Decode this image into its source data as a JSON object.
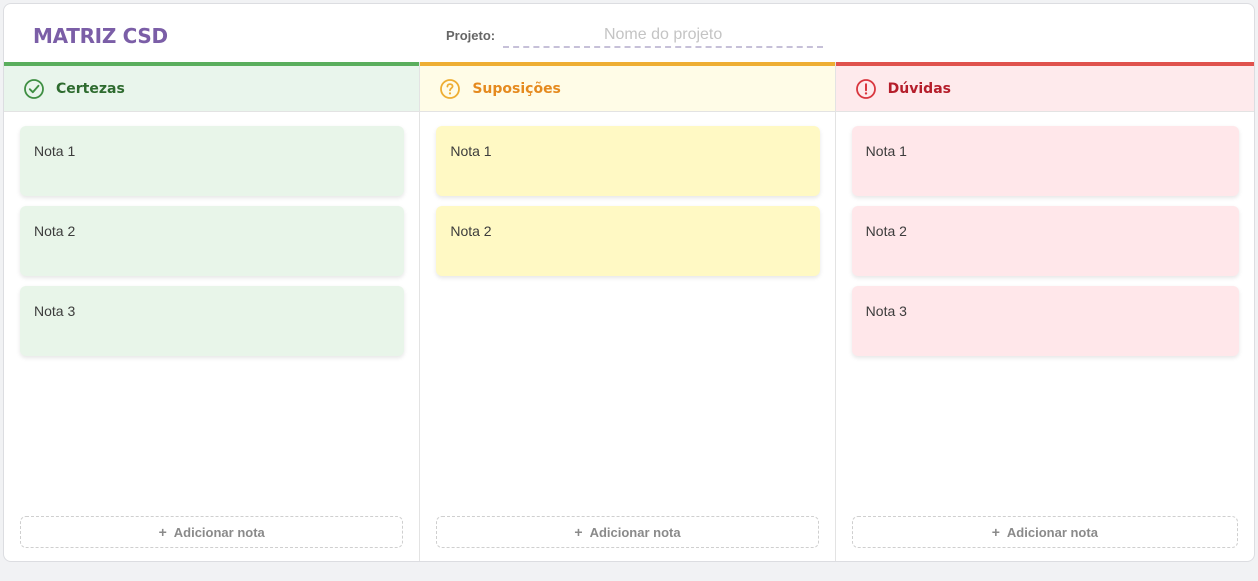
{
  "header": {
    "title": "MATRIZ CSD",
    "project_label": "Projeto:",
    "project_placeholder": "Nome do projeto",
    "project_value": "",
    "title_color": "#7b5ea7"
  },
  "columns": [
    {
      "title": "Certezas",
      "icon": "check-circle-icon",
      "accent_color": "#5aae5d",
      "notes": [
        "Nota 1",
        "Nota 2",
        "Nota 3"
      ],
      "add_label": "Adicionar nota",
      "add_icon": "+"
    },
    {
      "title": "Suposições",
      "icon": "question-circle-icon",
      "accent_color": "#eeae33",
      "notes": [
        "Nota 1",
        "Nota 2"
      ],
      "add_label": "Adicionar nota",
      "add_icon": "+"
    },
    {
      "title": "Dúvidas",
      "icon": "exclamation-circle-icon",
      "accent_color": "#e0524d",
      "notes": [
        "Nota 1",
        "Nota 2",
        "Nota 3"
      ],
      "add_label": "Adicionar nota",
      "add_icon": "+"
    }
  ]
}
